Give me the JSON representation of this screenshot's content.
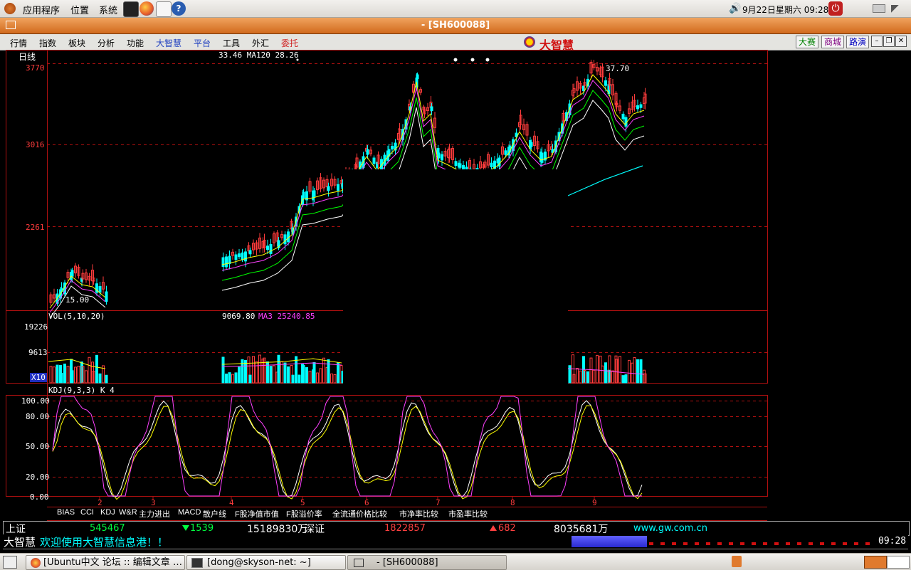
{
  "top_panel": {
    "menus": [
      "应用程序",
      "位置",
      "系统"
    ],
    "clock": "9月22日星期六 09:28"
  },
  "window": {
    "title": "- [SH600088]"
  },
  "menubar": {
    "items": [
      "行情",
      "指数",
      "板块",
      "分析",
      "功能",
      "大智慧",
      "平台",
      "工具",
      "外汇",
      "委托"
    ],
    "brand": "大智慧",
    "tools": [
      "大赛",
      "商城",
      "路演"
    ]
  },
  "chart": {
    "period": "日线",
    "price_axis": [
      "3770",
      "3016",
      "2261"
    ],
    "ma_label": "33.46  MA120  28.26",
    "high_label": "37.70",
    "low_label": "15.00",
    "vol_label": "VOL(5,10,20)",
    "vol_value": "9069.80",
    "vol_ma_label": "MA3  25240.85",
    "vol_axis": [
      "19226",
      "9613",
      "X10"
    ],
    "kdj_label": "KDJ(9,3,3)  K 4",
    "kdj_axis": [
      "100.00",
      "80.00",
      "50.00",
      "20.00",
      "0.00"
    ],
    "months": [
      "2",
      "3",
      "4",
      "5",
      "6",
      "7",
      "8",
      "9"
    ]
  },
  "tabs": [
    "BIAS",
    "CCI",
    "KDJ",
    "W&R",
    "主力进出",
    "MACD",
    "散户线",
    "F股净值市值",
    "F股溢价率",
    "全流通价格比较",
    "市净率比较",
    "市盈率比较"
  ],
  "status": {
    "sh_label": "上证",
    "sh_index": "545467",
    "sh_change": "1539",
    "sh_volume": "15189830万",
    "sz_label": "深证",
    "sz_index": "1822857",
    "sz_change": "682",
    "sz_volume": "8035681万",
    "url": "www.gw.com.cn",
    "ticker_brand": "大智慧",
    "ticker_text": "欢迎使用大智慧信息港！！",
    "time": "09:28"
  },
  "taskbar": {
    "tasks": [
      "[Ubuntu中文 论坛 :: 编辑文章 …",
      "[dong@skyson-net: ~]",
      "- [SH600088]"
    ]
  },
  "colors": {
    "up": "#ff3c3c",
    "down": "#00ffff",
    "ma_white": "#ffffff",
    "ma_yellow": "#ffff00",
    "ma_magenta": "#ff40ff",
    "ma_green": "#00ff00",
    "title_orange": "#d16a1d"
  }
}
